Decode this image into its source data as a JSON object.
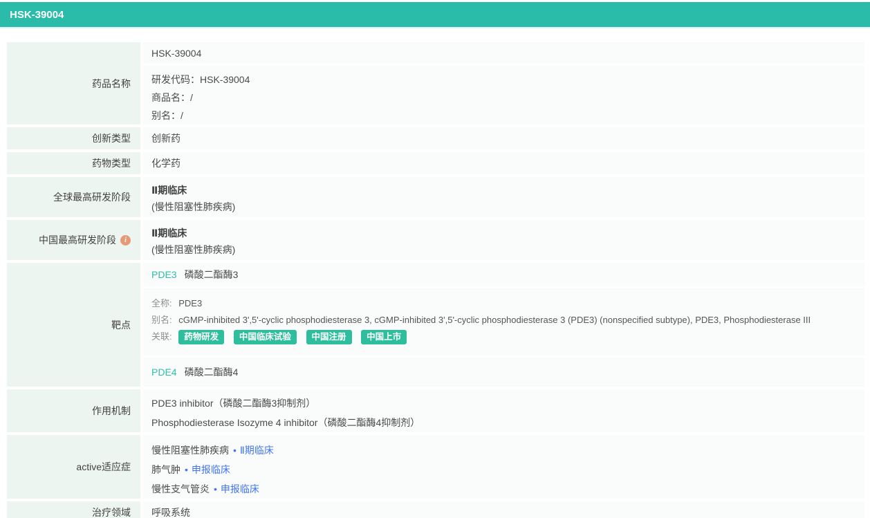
{
  "header": {
    "title": "HSK-39004"
  },
  "colors": {
    "accent_teal": "#2abca9",
    "label_bg": "#edf5f1",
    "value_bg": "#fafcfb",
    "tag_green": "#2fbe9d",
    "link_teal": "#2dbfa7",
    "link_blue": "#4173f2",
    "info_icon": "#e69b76"
  },
  "rows": {
    "drug_name": {
      "label": "药品名称",
      "primary_name": "HSK-39004",
      "fields": [
        {
          "label": "研发代码：",
          "value": "HSK-39004"
        },
        {
          "label": "商品名：",
          "value": "/"
        },
        {
          "label": "别名：",
          "value": "/"
        }
      ]
    },
    "innovation_type": {
      "label": "创新类型",
      "value": "创新药"
    },
    "drug_type": {
      "label": "药物类型",
      "value": "化学药"
    },
    "global_stage": {
      "label": "全球最高研发阶段",
      "phase": "Ⅱ期临床",
      "indication": "(慢性阻塞性肺疾病)"
    },
    "china_stage": {
      "label": "中国最高研发阶段",
      "info_icon_glyph": "i",
      "phase": "Ⅱ期临床",
      "indication": "(慢性阻塞性肺疾病)"
    },
    "target": {
      "label": "靶点",
      "target1": {
        "code": "PDE3",
        "name": "磷酸二酯酶3"
      },
      "target2": {
        "code": "PDE4",
        "name": "磷酸二酯酶4"
      },
      "detail": {
        "full_name_label": "全称:",
        "full_name": "PDE3",
        "alias_label": "别名:",
        "alias": "cGMP-inhibited 3',5'-cyclic phosphodiesterase 3, cGMP-inhibited 3',5'-cyclic phosphodiesterase 3 (PDE3) (nonspecified subtype), PDE3, Phosphodiesterase III",
        "relation_label": "关联:",
        "tags": [
          "药物研发",
          "中国临床试验",
          "中国注册",
          "中国上市"
        ]
      }
    },
    "mechanism": {
      "label": "作用机制",
      "items": [
        "PDE3 inhibitor（磷酸二酯酶3抑制剂）",
        "Phosphodiesterase Isozyme 4 inhibitor（磷酸二酯酶4抑制剂）"
      ]
    },
    "active_indications": {
      "label": "active适应症",
      "separator": "•",
      "items": [
        {
          "disease": "慢性阻塞性肺疾病",
          "status": "Ⅱ期临床"
        },
        {
          "disease": "肺气肿",
          "status": "申报临床"
        },
        {
          "disease": "慢性支气管炎",
          "status": "申报临床"
        }
      ]
    },
    "therapeutic_area": {
      "label": "治疗领域",
      "value": "呼吸系统"
    }
  }
}
